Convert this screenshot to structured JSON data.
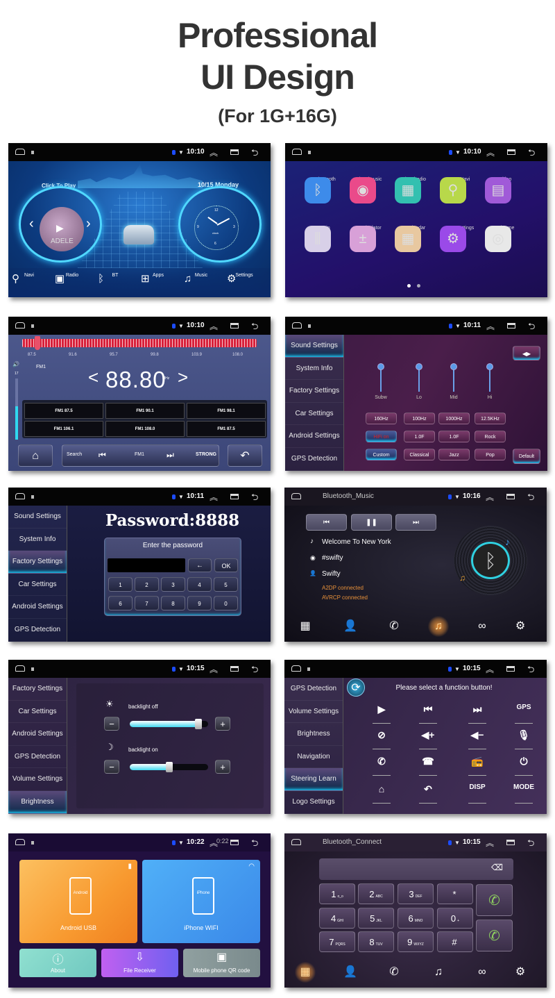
{
  "header": {
    "title_line1": "Professional",
    "title_line2": "UI Design",
    "subtitle": "(For 1G+16G)"
  },
  "home": {
    "time": "10:10",
    "click_to_play": "Click To Play",
    "album_text": "ADELE",
    "date": "10/15 Monday",
    "clock_label": "clock",
    "clock_numbers": [
      "12",
      "3",
      "6",
      "9"
    ],
    "dock": [
      {
        "label": "Navi",
        "icon": "location-pin-icon"
      },
      {
        "label": "Radio",
        "icon": "radio-icon"
      },
      {
        "label": "BT",
        "icon": "bluetooth-icon"
      },
      {
        "label": "Apps",
        "icon": "apps-grid-icon"
      },
      {
        "label": "Music",
        "icon": "music-note-icon"
      },
      {
        "label": "Settings",
        "icon": "gear-icon"
      }
    ]
  },
  "apps": {
    "time": "10:10",
    "items": [
      {
        "label": "Bluetooth",
        "icon": "bluetooth-icon",
        "color": "#3d8bea"
      },
      {
        "label": "localmusic",
        "icon": "music-disc-icon",
        "color": "#ea4a8a"
      },
      {
        "label": "localradio",
        "icon": "radio-icon",
        "color": "#33c0b0"
      },
      {
        "label": "Net Navi",
        "icon": "map-pin-icon",
        "color": "#b8d84a"
      },
      {
        "label": "video",
        "icon": "clapper-icon",
        "color": "#a05ad8"
      },
      {
        "label": "Avin",
        "icon": "av-in-icon",
        "color": "#d8d0e8"
      },
      {
        "label": "Calculator",
        "icon": "calculator-icon",
        "color": "#d8a0d8"
      },
      {
        "label": "Calendar",
        "icon": "calendar-icon",
        "color": "#e8c8a0"
      },
      {
        "label": "Car Settings",
        "icon": "gear-icon",
        "color": "#9a4ae8"
      },
      {
        "label": "Chrome",
        "icon": "chrome-icon",
        "color": "#e8e8e8"
      }
    ],
    "page_count": 2,
    "current_page": 1
  },
  "radio": {
    "time": "10:10",
    "scale": [
      "87.5",
      "91.6",
      "95.7",
      "99.8",
      "103.9",
      "108.0"
    ],
    "band": "FM1",
    "frequency": "88.80",
    "unit": "MHz",
    "tuned_mhz": 88.8,
    "volume": "17",
    "volume_level": 0.55,
    "presets": [
      "FM1 87.5",
      "FM1 90.1",
      "FM1 98.1",
      "FM1 106.1",
      "FM1 108.0",
      "FM1 87.5"
    ],
    "controls": {
      "search": "Search",
      "band": "FM1",
      "signal": "STRONG"
    }
  },
  "sound": {
    "time": "10:11",
    "menu": [
      "Sound Settings",
      "System Info",
      "Factory Settings",
      "Car Settings",
      "Android Settings",
      "GPS Detection"
    ],
    "active": "Sound Settings",
    "bands": [
      "Subw",
      "Lo",
      "Mid",
      "Hi"
    ],
    "row1": [
      "160Hz",
      "100Hz",
      "1000Hz",
      "12.5KHz"
    ],
    "row2": [
      "HiFi on",
      "1.0F",
      "1.0F",
      "Rock"
    ],
    "row3": [
      "Custom",
      "Classical",
      "Jazz",
      "Pop"
    ],
    "default": "Default"
  },
  "password": {
    "time": "10:11",
    "menu": [
      "Sound Settings",
      "System Info",
      "Factory Settings",
      "Car Settings",
      "Android Settings",
      "GPS Detection"
    ],
    "active": "Factory Settings",
    "title": "Password:8888",
    "prompt": "Enter the password",
    "backspace": "←",
    "ok": "OK",
    "keys": [
      "1",
      "2",
      "3",
      "4",
      "5",
      "6",
      "7",
      "8",
      "9",
      "0"
    ]
  },
  "btmusic": {
    "title": "Bluetooth_Music",
    "time": "10:16",
    "song": "Welcome To New York",
    "album": "#swifty",
    "artist": "Swifty",
    "status": [
      "A2DP connected",
      "AVRCP connected"
    ],
    "tabs": [
      {
        "icon": "dialpad-icon"
      },
      {
        "icon": "contacts-icon"
      },
      {
        "icon": "call-log-icon"
      },
      {
        "icon": "music-icon",
        "active": true
      },
      {
        "icon": "link-icon"
      },
      {
        "icon": "gear-icon"
      }
    ]
  },
  "brightness": {
    "time": "10:15",
    "menu": [
      "Factory Settings",
      "Car Settings",
      "Android Settings",
      "GPS Detection",
      "Volume Settings",
      "Brightness"
    ],
    "active": "Brightness",
    "backlight_off": {
      "label": "backlight off",
      "level": 0.88
    },
    "backlight_on": {
      "label": "backlight on",
      "level": 0.5
    },
    "minus": "−",
    "plus": "+"
  },
  "steering": {
    "time": "10:15",
    "menu": [
      "GPS Detection",
      "Volume Settings",
      "Brightness",
      "Navigation",
      "Steering Learn",
      "Logo Settings"
    ],
    "active": "Steering Learn",
    "prompt": "Please select a function button!",
    "buttons": [
      {
        "glyph": "▶",
        "name": "play-icon"
      },
      {
        "glyph": "⏮",
        "name": "previous-icon"
      },
      {
        "glyph": "⏭",
        "name": "next-icon"
      },
      {
        "glyph": "GPS",
        "name": "gps-button"
      },
      {
        "glyph": "⊘",
        "name": "mute-icon"
      },
      {
        "glyph": "◀+",
        "name": "volume-up-icon"
      },
      {
        "glyph": "◀−",
        "name": "volume-down-icon"
      },
      {
        "glyph": "🎙",
        "name": "microphone-icon"
      },
      {
        "glyph": "✆",
        "name": "phone-answer-icon"
      },
      {
        "glyph": "☎",
        "name": "phone-hangup-icon"
      },
      {
        "glyph": "📻",
        "name": "radio-icon"
      },
      {
        "glyph": "⏻",
        "name": "power-icon"
      },
      {
        "glyph": "⌂",
        "name": "home-icon"
      },
      {
        "glyph": "↶",
        "name": "back-icon"
      },
      {
        "glyph": "DISP",
        "name": "disp-button"
      },
      {
        "glyph": "MODE",
        "name": "mode-button"
      }
    ]
  },
  "phonelink": {
    "time": "10:22",
    "ghost_time": "0:22",
    "android": {
      "label": "Android USB",
      "screen": "Android"
    },
    "iphone": {
      "label": "iPhone WIFI",
      "screen": "iPhone"
    },
    "about": "About",
    "file_receiver": "File Receiver",
    "qr": "Mobile phone QR code"
  },
  "dialer": {
    "title": "Bluetooth_Connect",
    "time": "10:15",
    "keys": [
      {
        "d": "1",
        "s": "o_o"
      },
      {
        "d": "2",
        "s": "ABC"
      },
      {
        "d": "3",
        "s": "DEF"
      },
      {
        "d": "*",
        "s": ""
      },
      {
        "d": "4",
        "s": "GHI"
      },
      {
        "d": "5",
        "s": "JKL"
      },
      {
        "d": "6",
        "s": "MNO"
      },
      {
        "d": "0",
        "s": "+"
      },
      {
        "d": "7",
        "s": "PQRS"
      },
      {
        "d": "8",
        "s": "TUV"
      },
      {
        "d": "9",
        "s": "WXYZ"
      },
      {
        "d": "#",
        "s": ""
      }
    ],
    "tabs": [
      {
        "icon": "dialpad-icon",
        "active": true
      },
      {
        "icon": "contacts-icon"
      },
      {
        "icon": "call-log-icon"
      },
      {
        "icon": "music-icon"
      },
      {
        "icon": "link-icon"
      },
      {
        "icon": "gear-icon"
      }
    ]
  },
  "colors": {
    "accent_cyan": "#20d0ff",
    "status_orange": "#e8913a",
    "tuner_red": "#e0203a"
  }
}
